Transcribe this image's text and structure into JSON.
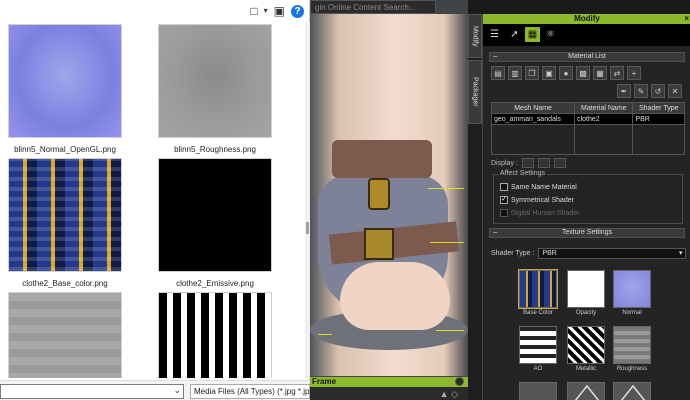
{
  "dialog": {
    "files": [
      {
        "caption": "blinn5_Normal_OpenGL.png",
        "kind": "normal"
      },
      {
        "caption": "blinn5_Roughness.png",
        "kind": "roughness"
      },
      {
        "caption": "clothe2_Base_color.png",
        "kind": "basecolor"
      },
      {
        "caption": "clothe2_Emissive.png",
        "kind": "black"
      },
      {
        "caption": "",
        "kind": "gray"
      },
      {
        "caption": "",
        "kind": "bw"
      }
    ],
    "filetype_label": "Media Files (All Types) (*.jpg *.jp",
    "filename_value": "",
    "help_label": "?"
  },
  "viewport": {
    "search_placeholder": "gin Online Content Search...",
    "frame_label": "Frame"
  },
  "side_tabs": {
    "modify": "Modify",
    "packager": "Packager"
  },
  "panel": {
    "title": "Modify",
    "close": "×",
    "material_list_title": "Material List",
    "table": {
      "headers": [
        "Mesh Name",
        "Material Name",
        "Shader Type"
      ],
      "rows": [
        [
          "geo_amman_sandals",
          "clothe2",
          "PBR"
        ]
      ]
    },
    "display_label": "Display :",
    "affect_settings_title": "Affect Settings",
    "checkboxes": [
      {
        "label": "Same Name Material",
        "checked": false,
        "disabled": false
      },
      {
        "label": "Symmetrical Shader",
        "checked": true,
        "disabled": false
      },
      {
        "label": "Digital Human Shader",
        "checked": false,
        "disabled": true
      }
    ],
    "texture_settings_title": "Texture Settings",
    "shader_type_label": "Shader Type :",
    "shader_type_value": "PBR",
    "textures": [
      {
        "label": "Base Color",
        "kind": "base"
      },
      {
        "label": "Opacity",
        "kind": "opacity"
      },
      {
        "label": "Normal",
        "kind": "normal"
      },
      {
        "label": "AO",
        "kind": "ao"
      },
      {
        "label": "Metallic",
        "kind": "metal"
      },
      {
        "label": "Roughness",
        "kind": "rough"
      },
      {
        "label": "",
        "kind": "empty"
      },
      {
        "label": "",
        "kind": "empty"
      },
      {
        "label": "",
        "kind": "empty"
      }
    ]
  },
  "colors": {
    "accent": "#8cb82b",
    "panel_bg": "#242424",
    "help_blue": "#1a73e8"
  }
}
